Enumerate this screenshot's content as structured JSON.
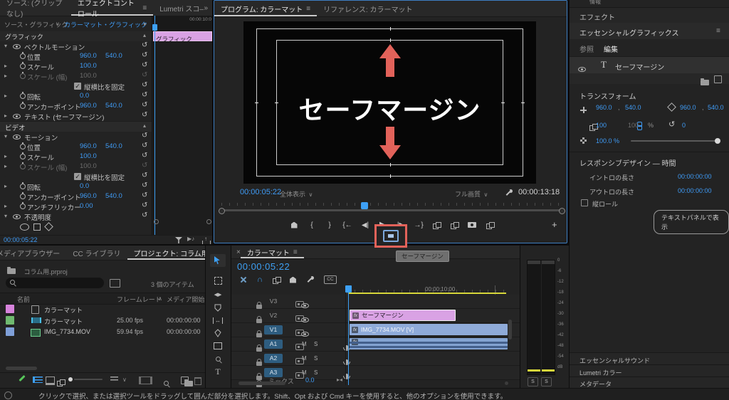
{
  "colors": {
    "accent_blue": "#3da0f5",
    "value_blue": "#3f9bf5",
    "annotation_red": "#e2625a",
    "clip_pink": "#d9a2e4",
    "clip_blue": "#8fabd9",
    "audio_clip_blue": "#84a4d2",
    "work_bar_yellow": "#d6d63a",
    "swatch_pink": "#d783dc",
    "swatch_green": "#6fb96f",
    "swatch_blue": "#7f9fd8"
  },
  "icons": {
    "menu": "≡",
    "chevrons": "»",
    "twirl_open": "▾",
    "twirl_closed": "▸",
    "collapse_up": "▴",
    "reset": "↺",
    "dropdown": "∨",
    "expand_right": "▸",
    "magnet": "∩",
    "cc": "CC",
    "brace_open": "{",
    "brace_close": "}",
    "goto_in": "{←",
    "goto_out": "→}",
    "step_back": "◀|",
    "play": "▶",
    "step_fwd": "|▶",
    "plus": "+",
    "close": "×",
    "fx": "fx",
    "text_tool": "T",
    "sort_asc": "∧",
    "fit": "▸◂",
    "slip": "↔",
    "rotate": "↺",
    "play_audio": "▶♪"
  },
  "effect_controls": {
    "tabs": [
      "ソース: (クリップなし)",
      "エフェクトコントロール",
      "Lumetri スコ―"
    ],
    "source_label": "ソース・グラフィック",
    "clip_name": "カラーマット・グラフィック",
    "mini_ruler_label": "00:00:10:0",
    "graphic_header": "グラフィック",
    "mini_clip_label": "グラフィック",
    "rows": [
      {
        "label": "ベクトルモーション"
      },
      {
        "label": "位置",
        "v1": "960.0",
        "v2": "540.0"
      },
      {
        "label": "スケール",
        "v1": "100.0"
      },
      {
        "label": "スケール (幅)",
        "v1": "100.0"
      },
      {
        "label": "縦横比を固定"
      },
      {
        "label": "回転",
        "v1": "0.0"
      },
      {
        "label": "アンカーポイント",
        "v1": "960.0",
        "v2": "540.0"
      },
      {
        "label": "テキスト (セーフマージン)"
      },
      {
        "label": "ビデオ"
      },
      {
        "label": "モーション"
      },
      {
        "label": "位置",
        "v1": "960.0",
        "v2": "540.0"
      },
      {
        "label": "スケール",
        "v1": "100.0"
      },
      {
        "label": "スケール (幅)",
        "v1": "100.0"
      },
      {
        "label": "縦横比を固定"
      },
      {
        "label": "回転",
        "v1": "0.0"
      },
      {
        "label": "アンカーポイント",
        "v1": "960.0",
        "v2": "540.0"
      },
      {
        "label": "アンチフリッカー",
        "v1": "0.00"
      },
      {
        "label": "不透明度"
      }
    ],
    "timecode": "00:00:05:22"
  },
  "program": {
    "tabs": [
      "プログラム: カラーマット",
      "リファレンス: カラーマット"
    ],
    "video_text": "セーフマージン",
    "timecode": "00:00:05:22",
    "zoom_level": "全体表示",
    "quality": "フル画質",
    "duration": "00:00:13:18"
  },
  "essential_graphics": {
    "info_tab": "情報",
    "effects_row": "エフェクト",
    "title": "エッセンシャルグラフィックス",
    "tabs": [
      "参照",
      "編集"
    ],
    "layer_name": "セーフマージン",
    "transform_title": "トランスフォーム",
    "pos_x": "960.0",
    "pos_y": "540.0",
    "comma": ",",
    "anchor_x": "960.0",
    "anchor_y": "540.0",
    "scale": "100",
    "scale_linked": "100",
    "percent": "%",
    "rotation": "0",
    "opacity": "100.0 %",
    "responsive_title": "レスポンシブデザイン — 時間",
    "intro_label": "イントロの長さ",
    "intro_value": "00:00:00:00",
    "outro_label": "アウトロの長さ",
    "outro_value": "00:00:00:00",
    "roll_label": "縦ロール",
    "text_panel_button": "テキストパネルで表示",
    "bottom_rows": [
      "エッセンシャルサウンド",
      "Lumetri カラー",
      "メタデータ"
    ]
  },
  "project": {
    "tabs": [
      "メディアブラウザー",
      "CC ライブラリ",
      "プロジェクト: コラム用"
    ],
    "breadcrumb": "コラム用.prproj",
    "item_count": "3 個のアイテム",
    "columns": [
      "名前",
      "フレームレート",
      "メディア開始"
    ],
    "rows": [
      {
        "name": "カラーマット",
        "fps": "",
        "start": ""
      },
      {
        "name": "カラーマット",
        "fps": "25.00 fps",
        "start": "00:00:00:00"
      },
      {
        "name": "IMG_7734.MOV",
        "fps": "59.94 fps",
        "start": "00:00:00:00"
      }
    ]
  },
  "timeline": {
    "tab": "カラーマット",
    "timecode": "00:00:05:22",
    "ruler_label": "00:00:10:00",
    "tracks": {
      "video": [
        {
          "name": "V3"
        },
        {
          "name": "V2"
        },
        {
          "name": "V1"
        }
      ],
      "audio": [
        {
          "name": "A1"
        },
        {
          "name": "A2"
        },
        {
          "name": "A3"
        }
      ]
    },
    "clips": {
      "v2_label": "セーフマージン",
      "v1_label": "IMG_7734.MOV [V]"
    },
    "mute_label": "M",
    "solo_label": "S",
    "mix_label": "ミックス",
    "mix_value": "0.0"
  },
  "meter": {
    "ticks": [
      "0",
      "-6",
      "-12",
      "-18",
      "-24",
      "-30",
      "-36",
      "-42",
      "-48",
      "-54",
      "dB"
    ],
    "solo": "S"
  },
  "annotation": {
    "tooltip": "セーフマージン"
  },
  "status_bar": "クリックで選択、または選択ツールをドラッグして囲んだ部分を選択します。Shift、Opt および Cmd キーを使用すると、他のオプションを使用できます。"
}
